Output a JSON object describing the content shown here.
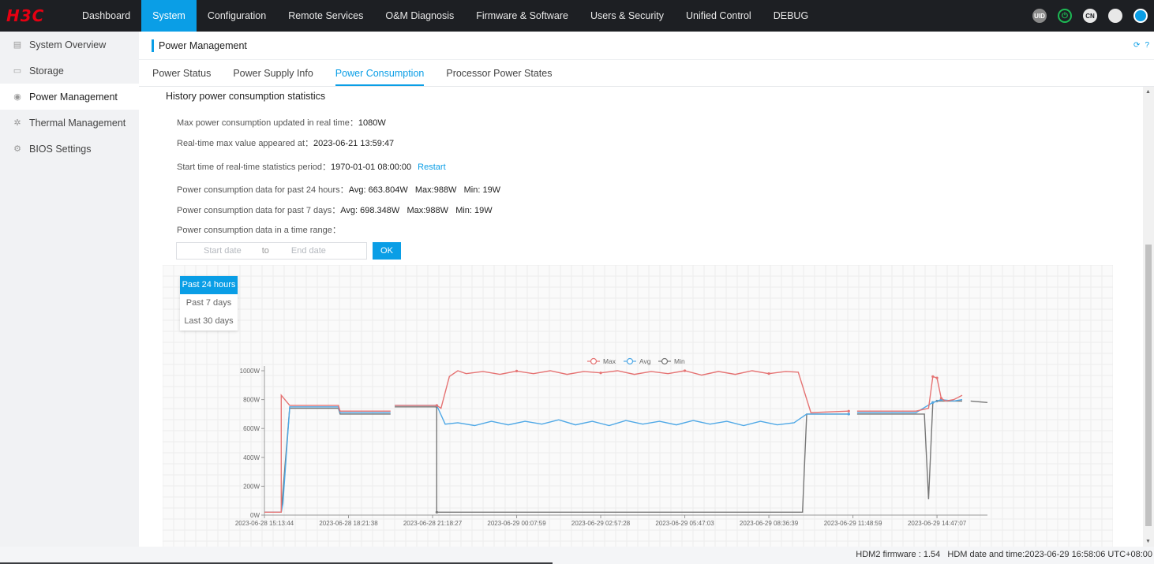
{
  "brand": {
    "logo": "H3C",
    "color": "#e60012"
  },
  "topnav": {
    "items": [
      "Dashboard",
      "System",
      "Configuration",
      "Remote Services",
      "O&M Diagnosis",
      "Firmware & Software",
      "Users & Security",
      "Unified Control",
      "DEBUG"
    ],
    "active_index": 1,
    "right_icons": [
      {
        "name": "uid-icon",
        "label": "UID"
      },
      {
        "name": "power-icon",
        "label": "⏻"
      },
      {
        "name": "language-icon",
        "label": "CN"
      },
      {
        "name": "shield-icon",
        "label": ""
      },
      {
        "name": "user-icon",
        "label": ""
      }
    ]
  },
  "sidebar": {
    "items": [
      {
        "label": "System Overview",
        "icon": "overview-icon"
      },
      {
        "label": "Storage",
        "icon": "storage-icon"
      },
      {
        "label": "Power Management",
        "icon": "power-management-icon"
      },
      {
        "label": "Thermal Management",
        "icon": "fan-icon"
      },
      {
        "label": "BIOS Settings",
        "icon": "bios-icon"
      }
    ],
    "active_index": 2
  },
  "page": {
    "title": "Power Management",
    "tabs": [
      "Power Status",
      "Power Supply Info",
      "Power Consumption",
      "Processor Power States"
    ],
    "active_tab": 2
  },
  "stats": {
    "section_title": "History power consumption statistics",
    "max_rt_label": "Max power consumption updated in real time：",
    "max_rt_value": "1080W",
    "max_time_label": "Real-time max value appeared at：",
    "max_time_value": "2023-06-21 13:59:47",
    "start_label": "Start time of real-time statistics period：",
    "start_value": "1970-01-01 08:00:00",
    "restart": "Restart",
    "day_label": "Power consumption data for past 24 hours：",
    "day_value": "Avg: 663.804W   Max:988W   Min: 19W",
    "week_label": "Power consumption data for past 7 days：",
    "week_value": "Avg: 698.348W   Max:988W   Min: 19W",
    "range_label": "Power consumption data in a time range："
  },
  "range_input": {
    "start_placeholder": "Start date",
    "to": "to",
    "end_placeholder": "End date",
    "ok": "OK"
  },
  "range_menu": {
    "items": [
      "Past 24 hours",
      "Past 7 days",
      "Last 30 days"
    ],
    "active_index": 0
  },
  "footer": {
    "text": "HDM2 firmware : 1.54   HDM date and time:2023-06-29 16:58:06 UTC+08:00"
  },
  "colors": {
    "accent": "#0a9ee6",
    "max": "#e57373",
    "avg": "#4fa8e6",
    "min": "#777777"
  },
  "chart_data": {
    "type": "line",
    "xlabel": "",
    "ylabel": "",
    "ylim": [
      0,
      1000
    ],
    "yticks": [
      "0W",
      "200W",
      "400W",
      "600W",
      "800W",
      "1000W"
    ],
    "xticks": [
      "2023-06-28 15:13:44",
      "2023-06-28 18:21:38",
      "2023-06-28 21:18:27",
      "2023-06-29 00:07:59",
      "2023-06-29 02:57:28",
      "2023-06-29 05:47:03",
      "2023-06-29 08:36:39",
      "2023-06-29 11:48:59",
      "2023-06-29 14:47:07"
    ],
    "x_range": [
      0,
      8.6
    ],
    "legend": "top-center",
    "grid": true,
    "series": [
      {
        "name": "Max",
        "points": [
          [
            0,
            20
          ],
          [
            0.2,
            20
          ],
          [
            0.2,
            830
          ],
          [
            0.3,
            760
          ],
          [
            0.88,
            760
          ],
          [
            0.9,
            720
          ],
          [
            1.5,
            720
          ],
          [
            null,
            null
          ],
          [
            1.55,
            760
          ],
          [
            2.05,
            760
          ],
          [
            2.1,
            740
          ],
          [
            2.2,
            960
          ],
          [
            2.3,
            1000
          ],
          [
            2.4,
            980
          ],
          [
            2.6,
            995
          ],
          [
            2.8,
            975
          ],
          [
            3.0,
            998
          ],
          [
            3.2,
            980
          ],
          [
            3.4,
            1000
          ],
          [
            3.6,
            975
          ],
          [
            3.8,
            995
          ],
          [
            4.0,
            985
          ],
          [
            4.2,
            1000
          ],
          [
            4.4,
            975
          ],
          [
            4.6,
            995
          ],
          [
            4.8,
            980
          ],
          [
            5.0,
            1000
          ],
          [
            5.2,
            970
          ],
          [
            5.4,
            995
          ],
          [
            5.6,
            975
          ],
          [
            5.8,
            1000
          ],
          [
            6.0,
            980
          ],
          [
            6.2,
            995
          ],
          [
            6.35,
            990
          ],
          [
            6.5,
            710
          ],
          [
            6.95,
            720
          ],
          [
            null,
            null
          ],
          [
            7.05,
            720
          ],
          [
            7.75,
            720
          ],
          [
            7.9,
            740
          ],
          [
            7.95,
            960
          ],
          [
            8.0,
            950
          ],
          [
            8.05,
            810
          ],
          [
            8.1,
            790
          ],
          [
            8.2,
            800
          ],
          [
            8.3,
            830
          ]
        ]
      },
      {
        "name": "Avg",
        "points": [
          [
            0,
            20
          ],
          [
            0.2,
            20
          ],
          [
            0.22,
            80
          ],
          [
            0.3,
            750
          ],
          [
            0.88,
            750
          ],
          [
            0.9,
            710
          ],
          [
            1.5,
            710
          ],
          [
            null,
            null
          ],
          [
            1.55,
            760
          ],
          [
            2.05,
            760
          ],
          [
            2.15,
            630
          ],
          [
            2.3,
            640
          ],
          [
            2.5,
            620
          ],
          [
            2.7,
            650
          ],
          [
            2.9,
            625
          ],
          [
            3.1,
            650
          ],
          [
            3.3,
            630
          ],
          [
            3.5,
            660
          ],
          [
            3.7,
            625
          ],
          [
            3.9,
            650
          ],
          [
            4.1,
            620
          ],
          [
            4.3,
            655
          ],
          [
            4.5,
            630
          ],
          [
            4.7,
            650
          ],
          [
            4.9,
            625
          ],
          [
            5.1,
            655
          ],
          [
            5.3,
            630
          ],
          [
            5.5,
            650
          ],
          [
            5.7,
            620
          ],
          [
            5.9,
            650
          ],
          [
            6.1,
            625
          ],
          [
            6.3,
            640
          ],
          [
            6.45,
            700
          ],
          [
            6.95,
            700
          ],
          [
            null,
            null
          ],
          [
            7.05,
            710
          ],
          [
            7.75,
            710
          ],
          [
            7.95,
            780
          ],
          [
            8.05,
            800
          ],
          [
            8.2,
            790
          ],
          [
            8.3,
            800
          ]
        ]
      },
      {
        "name": "Min",
        "points": [
          [
            0,
            20
          ],
          [
            0.2,
            20
          ],
          [
            0.2,
            20
          ],
          [
            0.3,
            740
          ],
          [
            0.88,
            740
          ],
          [
            0.9,
            700
          ],
          [
            1.5,
            700
          ],
          [
            null,
            null
          ],
          [
            1.55,
            750
          ],
          [
            2.05,
            750
          ],
          [
            2.05,
            20
          ],
          [
            6.4,
            20
          ],
          [
            6.45,
            700
          ],
          [
            6.95,
            700
          ],
          [
            null,
            null
          ],
          [
            7.05,
            700
          ],
          [
            7.75,
            700
          ],
          [
            7.85,
            700
          ],
          [
            7.9,
            110
          ],
          [
            7.95,
            780
          ],
          [
            8.0,
            790
          ],
          [
            8.3,
            790
          ],
          [
            null,
            null
          ],
          [
            8.4,
            790
          ],
          [
            8.6,
            780
          ]
        ]
      }
    ]
  }
}
